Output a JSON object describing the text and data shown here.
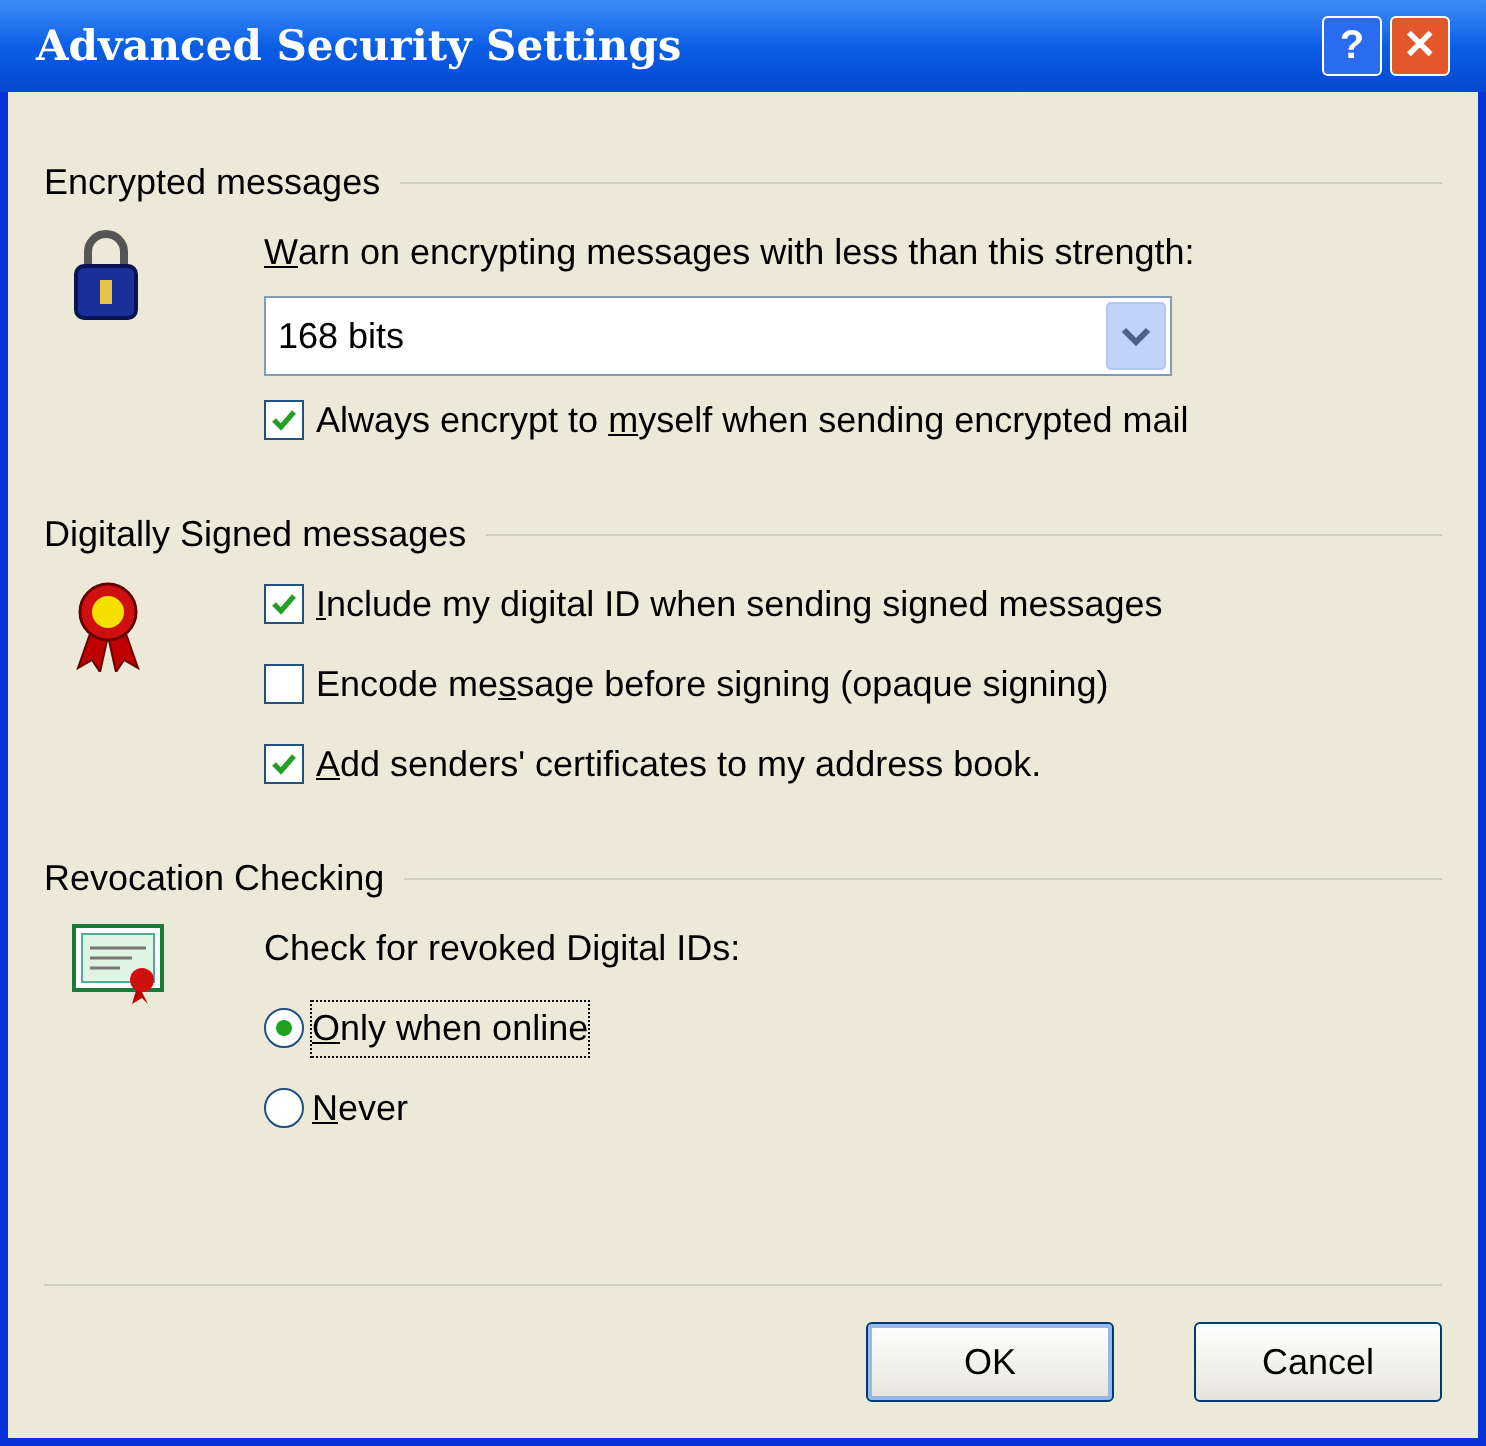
{
  "window": {
    "title": "Advanced Security Settings"
  },
  "title_buttons": [
    {
      "kind": "help",
      "label": "?"
    },
    {
      "kind": "close",
      "label": "✕"
    }
  ],
  "sections": [
    {
      "heading": "Encrypted messages",
      "items": [
        {
          "kind": "label",
          "text": {
            "key": "W",
            "post": "arn on encrypting messages with less than this strength:"
          }
        },
        {
          "kind": "dropdown",
          "value": "168 bits"
        },
        {
          "kind": "checkbox",
          "checked": true,
          "text": {
            "pre": "Always encrypt to ",
            "key": "m",
            "post": "yself when sending encrypted mail"
          }
        }
      ]
    },
    {
      "heading": "Digitally Signed messages",
      "items": [
        {
          "kind": "checkbox",
          "checked": true,
          "text": {
            "key": "I",
            "post": "nclude my digital ID when sending signed messages"
          }
        },
        {
          "kind": "checkbox",
          "checked": false,
          "text": {
            "pre": "Encode me",
            "key": "s",
            "post": "sage before signing (opaque signing)"
          }
        },
        {
          "kind": "checkbox",
          "checked": true,
          "text": {
            "key": "A",
            "post": "dd senders' certificates to my address book."
          }
        }
      ]
    },
    {
      "heading": "Revocation Checking",
      "items": [
        {
          "kind": "label",
          "text": {
            "pre": "Check for revoked Digital IDs:"
          }
        },
        {
          "kind": "radio",
          "selected": true,
          "focused": true,
          "text": {
            "key": "O",
            "post": "nly when online"
          }
        },
        {
          "kind": "radio",
          "selected": false,
          "focused": false,
          "text": {
            "key": "N",
            "post": "ever"
          }
        }
      ]
    }
  ],
  "buttons": [
    {
      "label": "OK",
      "default": true
    },
    {
      "label": "Cancel",
      "default": false
    }
  ]
}
